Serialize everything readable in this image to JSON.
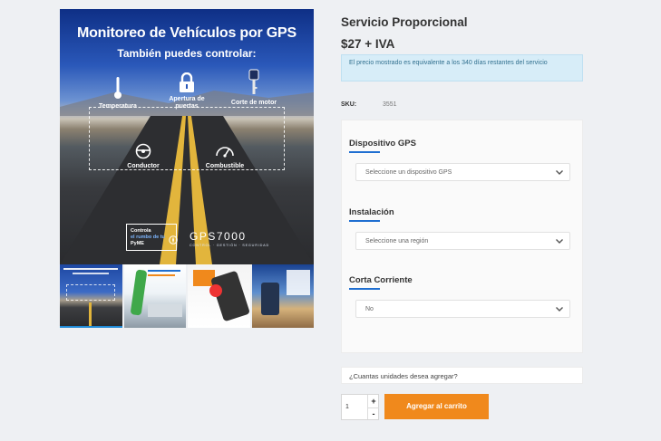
{
  "hero": {
    "title": "Monitoreo de Vehículos por GPS",
    "subtitle": "También puedes controlar:",
    "features": [
      "Temperatura",
      "Apertura de puertas",
      "Corte de motor",
      "Conductor",
      "Combustible"
    ],
    "badge_line1": "Controla",
    "badge_line2": "el rumbo de tu",
    "badge_line3": "PyME",
    "brand": "GPS7000",
    "brand_sub": "CONTROL · GESTIÓN · SEGURIDAD"
  },
  "thumbnails": [
    {
      "name": "thumb-1",
      "active": true
    },
    {
      "name": "thumb-2",
      "active": false
    },
    {
      "name": "thumb-3",
      "active": false
    },
    {
      "name": "thumb-4",
      "active": false
    }
  ],
  "product": {
    "title": "Servicio Proporcional",
    "price": "$27 + IVA",
    "notice": "El precio mostrado es equivalente a los 340 días restantes del servicio",
    "sku_label": "SKU:",
    "sku_value": "3551"
  },
  "options": [
    {
      "label": "Dispositivo GPS",
      "selected": "Seleccione un dispositivo GPS"
    },
    {
      "label": "Instalación",
      "selected": "Seleccione una región"
    },
    {
      "label": "Corta Corriente",
      "selected": "No"
    }
  ],
  "cart": {
    "quantity_question": "¿Cuantas unidades desea agregar?",
    "quantity": "1",
    "plus": "+",
    "minus": "-",
    "add_label": "Agregar al carrito"
  },
  "colors": {
    "accent": "#f0891c",
    "link_blue": "#1f6fd1",
    "notice_bg": "#d7edf8",
    "notice_text": "#31708f",
    "page_bg": "#eef0f3"
  }
}
